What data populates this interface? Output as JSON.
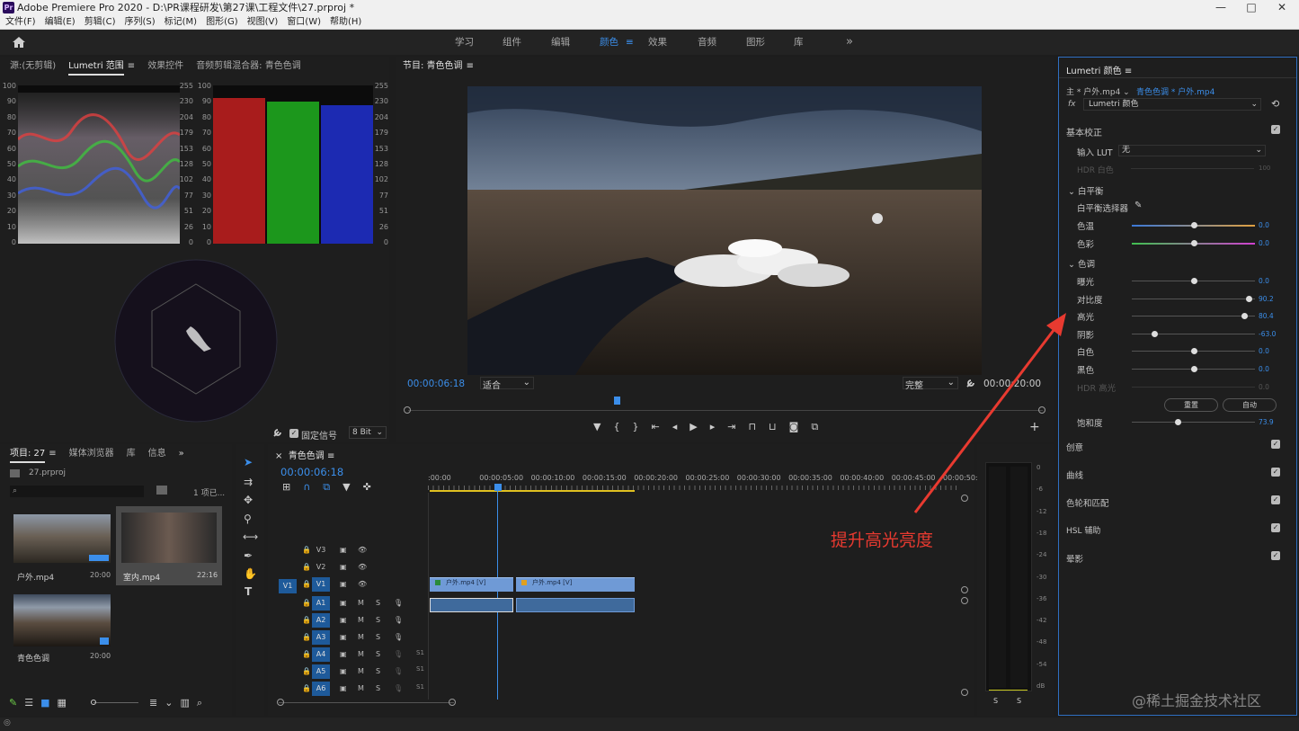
{
  "window": {
    "app_icon": "Pr",
    "title": "Adobe Premiere Pro 2020 - D:\\PR课程研发\\第27课\\工程文件\\27.prproj *",
    "minimize": "—",
    "maximize": "□",
    "close": "✕"
  },
  "menu": [
    "文件(F)",
    "编辑(E)",
    "剪辑(C)",
    "序列(S)",
    "标记(M)",
    "图形(G)",
    "视图(V)",
    "窗口(W)",
    "帮助(H)"
  ],
  "workspaces": [
    "学习",
    "组件",
    "编辑",
    "颜色",
    "效果",
    "音频",
    "图形",
    "库"
  ],
  "active_workspace": "颜色",
  "more_glyph": "»",
  "scopes": {
    "tabs": [
      "源:(无剪辑)",
      "Lumetri 范围",
      "效果控件",
      "音频剪辑混合器: 青色色调"
    ],
    "left_scale": [
      "100",
      "90",
      "80",
      "70",
      "60",
      "50",
      "40",
      "30",
      "20",
      "10",
      "0"
    ],
    "right_scale": [
      "255",
      "230",
      "204",
      "179",
      "153",
      "128",
      "102",
      "77",
      "51",
      "26",
      "0"
    ],
    "fixed_signal": "固定信号",
    "bit_depth": "8 Bit"
  },
  "program": {
    "title": "节目: 青色色调",
    "timecode": "00:00:06:18",
    "fit": "适合",
    "quality": "完整",
    "end_timecode": "00:00:20:00"
  },
  "project": {
    "tabs": [
      "项目: 27",
      "媒体浏览器",
      "库",
      "信息"
    ],
    "file": "27.prproj",
    "items_count": "1 项已...",
    "items": [
      {
        "name": "户外.mp4",
        "duration": "20:00"
      },
      {
        "name": "室内.mp4",
        "duration": "22:16"
      },
      {
        "name": "青色色调",
        "duration": "20:00"
      }
    ]
  },
  "timeline": {
    "title": "青色色调",
    "timecode": "00:00:06:18",
    "ruler": [
      ":00:00",
      "00:00:05:00",
      "00:00:10:00",
      "00:00:15:00",
      "00:00:20:00",
      "00:00:25:00",
      "00:00:30:00",
      "00:00:35:00",
      "00:00:40:00",
      "00:00:45:00",
      "00:00:50:0"
    ],
    "video_tracks": [
      "V3",
      "V2",
      "V1"
    ],
    "audio_tracks": [
      "A1",
      "A2",
      "A3",
      "A4",
      "A5",
      "A6"
    ],
    "clips": {
      "v1a": "户外.mp4 [V]",
      "v1b": "户外.mp4 [V]"
    },
    "s1": "S1"
  },
  "meter": {
    "scale": [
      "0",
      "-6",
      "-12",
      "-18",
      "-24",
      "-30",
      "-36",
      "-42",
      "-48",
      "-54",
      "dB"
    ],
    "solo": [
      "S",
      "S"
    ]
  },
  "lumetri": {
    "title": "Lumetri 颜色",
    "master": "主 * 户外.mp4",
    "clip": "青色色调 * 户外.mp4",
    "fx": "Lumetri 颜色",
    "basic": "基本校正",
    "input_lut_label": "输入 LUT",
    "input_lut_value": "无",
    "hdr_white": "HDR 白色",
    "hdr_white_val": "100",
    "wb_section": "白平衡",
    "wb_selector": "白平衡选择器",
    "temp": "色温",
    "temp_val": "0.0",
    "tint": "色彩",
    "tint_val": "0.0",
    "tone_section": "色调",
    "exposure": "曝光",
    "exposure_val": "0.0",
    "contrast": "对比度",
    "contrast_val": "90.2",
    "highlights": "高光",
    "highlights_val": "80.4",
    "shadows": "阴影",
    "shadows_val": "-63.0",
    "whites": "白色",
    "whites_val": "0.0",
    "blacks": "黑色",
    "blacks_val": "0.0",
    "hdr_spec": "HDR 高光",
    "hdr_spec_val": "0.0",
    "reset": "重置",
    "auto": "自动",
    "saturation": "饱和度",
    "saturation_val": "73.9",
    "sections": [
      "创意",
      "曲线",
      "色轮和匹配",
      "HSL 辅助",
      "晕影"
    ]
  },
  "annotation": "提升高光亮度",
  "watermark": "@稀土掘金技术社区"
}
